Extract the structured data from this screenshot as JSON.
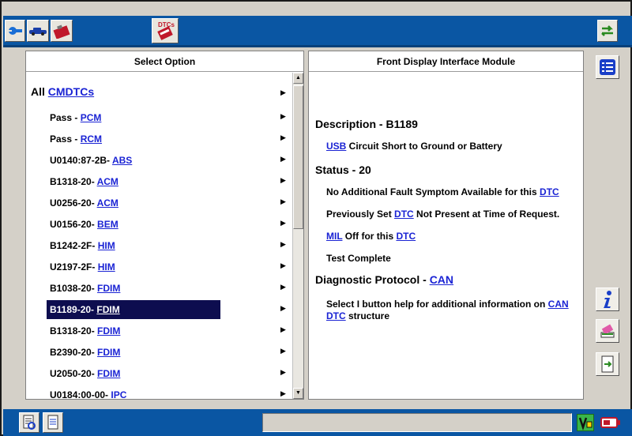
{
  "toolbar": {
    "tabs": [
      {
        "name": "connect-icon"
      },
      {
        "name": "vehicle-icon"
      },
      {
        "name": "toolbox-icon"
      },
      {
        "name": "dtc-icon",
        "label": "DTCs"
      }
    ],
    "switch_icon": "swap-arrows-icon"
  },
  "left_panel": {
    "title": "Select Option",
    "header_prefix": "All",
    "header_link": "CMDTCs",
    "items": [
      {
        "prefix": "Pass - ",
        "link": "PCM"
      },
      {
        "prefix": "Pass - ",
        "link": "RCM"
      },
      {
        "prefix": "U0140:87-2B- ",
        "link": "ABS"
      },
      {
        "prefix": "B1318-20- ",
        "link": "ACM"
      },
      {
        "prefix": "U0256-20- ",
        "link": "ACM"
      },
      {
        "prefix": "U0156-20- ",
        "link": "BEM"
      },
      {
        "prefix": "B1242-2F- ",
        "link": "HIM"
      },
      {
        "prefix": "U2197-2F- ",
        "link": "HIM"
      },
      {
        "prefix": "B1038-20- ",
        "link": "FDIM"
      },
      {
        "prefix": "B1189-20- ",
        "link": "FDIM",
        "selected": true
      },
      {
        "prefix": "B1318-20- ",
        "link": "FDIM"
      },
      {
        "prefix": "B2390-20- ",
        "link": "FDIM"
      },
      {
        "prefix": "U2050-20- ",
        "link": "FDIM"
      },
      {
        "prefix": "U0184:00-00- ",
        "link": "IPC"
      }
    ]
  },
  "right_panel": {
    "title": "Front Display Interface Module",
    "description_heading": "Description - B1189",
    "description_link": "USB",
    "description_text": " Circuit Short to Ground or Battery",
    "status_heading": "Status - 20",
    "status_line1_text": "No Additional Fault Symptom Available for this ",
    "status_line1_link": "DTC",
    "status_line2_a": "Previously Set ",
    "status_line2_link": "DTC",
    "status_line2_b": " Not Present at Time of Request.",
    "status_line3_link1": "MIL",
    "status_line3_text": " Off for this ",
    "status_line3_link2": "DTC",
    "status_line4": "Test Complete",
    "protocol_heading": "Diagnostic Protocol - ",
    "protocol_link": "CAN",
    "protocol_text": "Select I button help for additional information on ",
    "protocol_link2": "CAN",
    "protocol_link3": "DTC",
    "protocol_text2": " structure"
  },
  "side_buttons": [
    "list-icon",
    "info-icon",
    "eraser-icon",
    "export-icon"
  ],
  "status_bar": {
    "left_buttons": [
      "report-icon",
      "notes-icon"
    ],
    "right_icons": [
      "voltage-icon",
      "battery-icon"
    ]
  },
  "colors": {
    "accent": "#0a56a3",
    "link": "#1a23d4",
    "selection": "#0d0d4f"
  }
}
